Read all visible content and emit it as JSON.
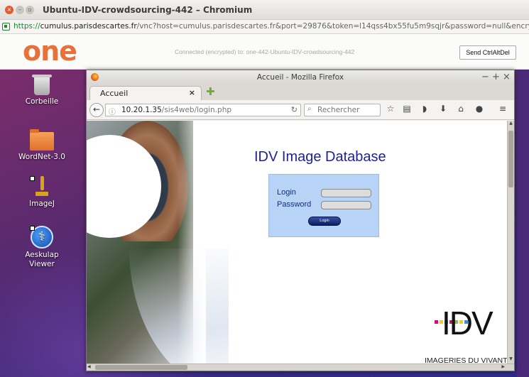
{
  "chromium": {
    "title": "Ubuntu-IDV-crowdsourcing-442 – Chromium",
    "url_scheme": "https://",
    "url_host": "cumulus.parisdescartes.fr",
    "url_rest": "/vnc?host=cumulus.parisdescartes.fr&port=29876&token=l14qss4bx55fu5m9sqjr&password=null&encrypt=yes&title=Ubuntu-ID"
  },
  "vnc": {
    "logo": "one",
    "status": "Connected (encrypted) to: one-442-Ubuntu-IDV-crowdsourcing-442",
    "send_cad": "Send CtrlAltDel"
  },
  "desktop": {
    "icons": [
      {
        "label": "Corbeille",
        "icon": "trash-icon"
      },
      {
        "label": "WordNet-3.0",
        "icon": "folder-icon"
      },
      {
        "label": "ImageJ",
        "icon": "microscope-icon"
      },
      {
        "label": "Aeskulap Viewer",
        "icon": "aesculapius-icon"
      }
    ]
  },
  "firefox": {
    "title": "Accueil - Mozilla Firefox",
    "tab_label": "Accueil",
    "url_host": "10.20.1.35",
    "url_path": "/sis4web/login.php",
    "search_placeholder": "Rechercher"
  },
  "page": {
    "heading": "IDV Image Database",
    "login_label": "Login",
    "password_label": "Password",
    "login_button": "Login",
    "logo_text": "IDV",
    "tagline": "IMAGERIES DU VIVANT",
    "logo_square_colors": [
      "#e6007e",
      "#ffcc00",
      "#3a8ddb",
      "#e6007e",
      "#7cc242",
      "#ffcc00",
      "#3a8ddb"
    ]
  }
}
